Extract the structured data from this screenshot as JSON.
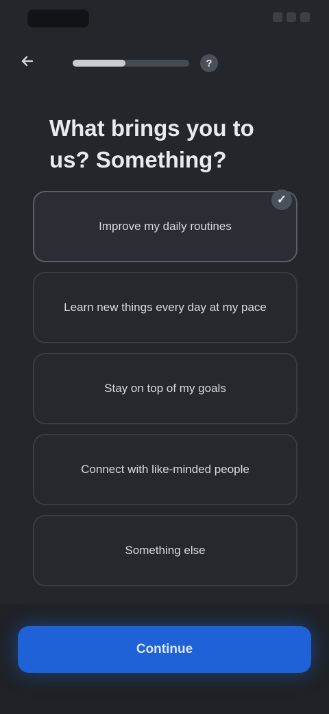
{
  "status_bar": {
    "time": ""
  },
  "header": {
    "back_icon": "arrow-left-icon",
    "progress_fraction": 0.45,
    "help_icon": "question-mark-icon",
    "help_glyph": "?"
  },
  "question": {
    "text": "What brings you to us? Something?"
  },
  "options": [
    {
      "label": "Improve my daily routines",
      "selected": true
    },
    {
      "label": "Learn new things every day at my pace",
      "selected": false
    },
    {
      "label": "Stay on top of my goals",
      "selected": false
    },
    {
      "label": "Connect with like-minded people",
      "selected": false
    },
    {
      "label": "Something else",
      "selected": false
    }
  ],
  "selected_check_glyph": "✓",
  "footer": {
    "continue_label": "Continue"
  },
  "colors": {
    "background": "#23272c",
    "accent": "#1f61d6"
  }
}
